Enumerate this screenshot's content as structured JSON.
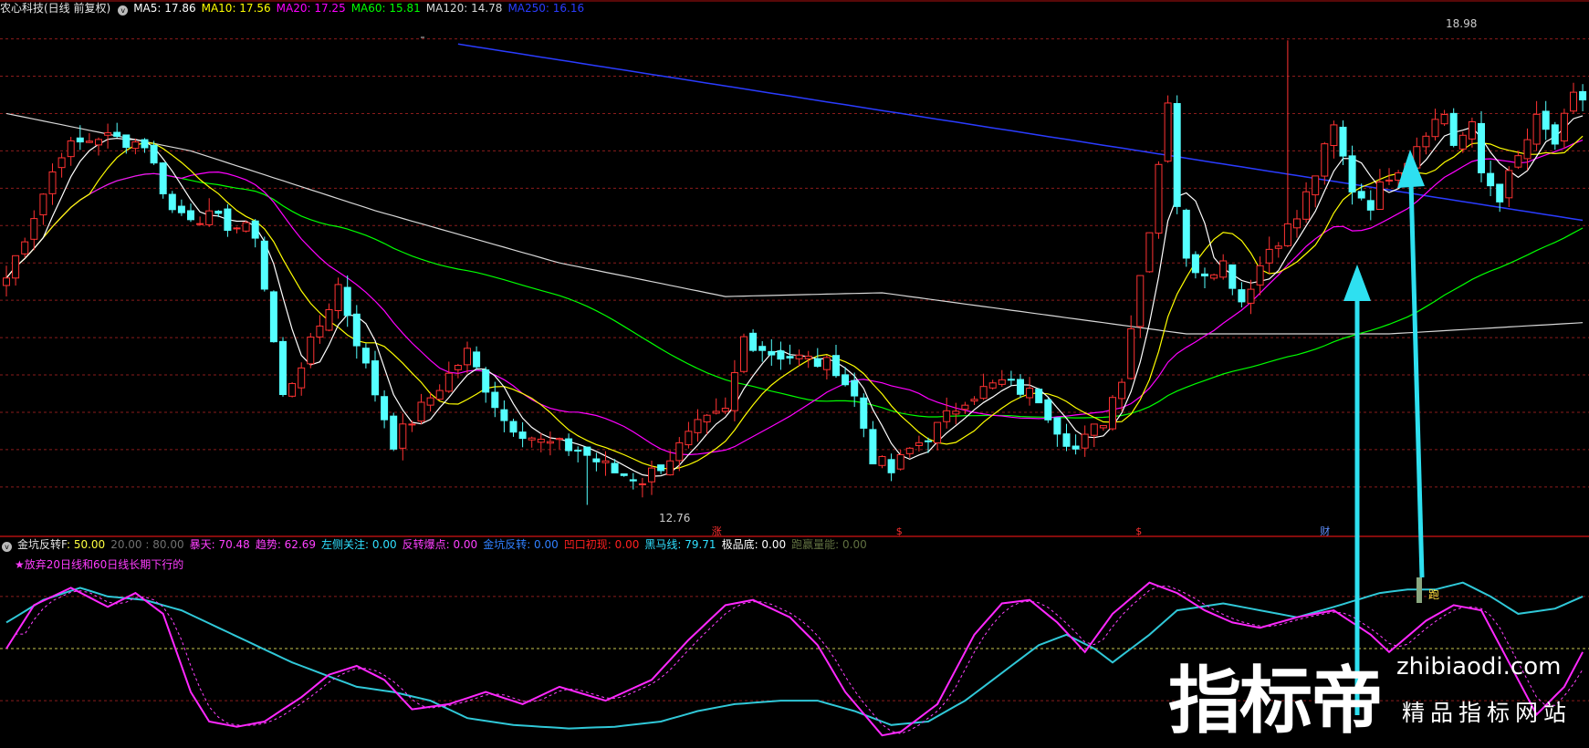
{
  "header": {
    "title": "农心科技(日线 前复权)",
    "indicators": [
      {
        "label": "MA5: 17.86",
        "color": "#ffffff"
      },
      {
        "label": "MA10: 17.56",
        "color": "#ffff00"
      },
      {
        "label": "MA20: 17.25",
        "color": "#ff00ff"
      },
      {
        "label": "MA60: 15.81",
        "color": "#00ff00"
      },
      {
        "label": "MA120: 14.78",
        "color": "#d8d8d8"
      },
      {
        "label": "MA250: 16.16",
        "color": "#2a3cff"
      }
    ]
  },
  "sub_header": {
    "title": "金坑反转F",
    "items": [
      {
        "label": ": 50.00",
        "color": "#ffff40"
      },
      {
        "label": "20.00 : 80.00",
        "color": "#707070"
      },
      {
        "label": "暴天: 70.48",
        "color": "#ff40ff"
      },
      {
        "label": "趋势: 62.69",
        "color": "#ff40ff"
      },
      {
        "label": "左侧关注: 0.00",
        "color": "#30e0ff"
      },
      {
        "label": "反转爆点: 0.00",
        "color": "#ff40ff"
      },
      {
        "label": "金坑反转: 0.00",
        "color": "#3080ff"
      },
      {
        "label": "凹口初现: 0.00",
        "color": "#ff2020"
      },
      {
        "label": "黑马线: 79.71",
        "color": "#30e0ff"
      },
      {
        "label": "极品底: 0.00",
        "color": "#ffffff"
      },
      {
        "label": "跑赢量能: 0.00",
        "color": "#607040"
      }
    ],
    "note": "★放弃20日线和60日线长期下行的"
  },
  "price_annotations": {
    "high_label": "18.98",
    "low_label": "12.76",
    "markers": [
      {
        "text": "涨",
        "color": "#ff3030",
        "index": 77
      },
      {
        "text": "$",
        "color": "#ff3030",
        "index": 97
      },
      {
        "text": "$",
        "color": "#ff3030",
        "index": 123
      },
      {
        "text": "财",
        "color": "#6090ff",
        "index": 143
      }
    ]
  },
  "signal_label": "跑",
  "watermark": {
    "big": "指标帝",
    "site": "zhibiaodi.com",
    "sub": "精品指标网站"
  },
  "colors": {
    "up": "#ff3232",
    "down": "#54ffff",
    "frame": "#b01010",
    "grid": "#8a1c1c"
  },
  "chart_data": [
    {
      "type": "candlestick",
      "title": "农心科技(日线 前复权)",
      "ylim": [
        12.4,
        19.3
      ],
      "levels": [
        13.0,
        13.5,
        14.0,
        14.5,
        15.0,
        15.5,
        16.0,
        16.5,
        17.0,
        17.5,
        18.0,
        18.5,
        19.0
      ],
      "series_names": [
        "MA5",
        "MA10",
        "MA20",
        "MA60",
        "MA120",
        "MA250"
      ],
      "pivots": [
        [
          0,
          15.8
        ],
        [
          6,
          17.5
        ],
        [
          10,
          17.7
        ],
        [
          15,
          17.6
        ],
        [
          18,
          16.7
        ],
        [
          22,
          16.6
        ],
        [
          27,
          16.4
        ],
        [
          30,
          14.2
        ],
        [
          33,
          14.9
        ],
        [
          36,
          15.7
        ],
        [
          39,
          14.6
        ],
        [
          42,
          13.6
        ],
        [
          46,
          14.2
        ],
        [
          50,
          14.8
        ],
        [
          54,
          13.9
        ],
        [
          58,
          13.6
        ],
        [
          62,
          13.5
        ],
        [
          66,
          13.2
        ],
        [
          69,
          13.1
        ],
        [
          72,
          13.4
        ],
        [
          75,
          13.8
        ],
        [
          78,
          14.0
        ],
        [
          80,
          15.0
        ],
        [
          83,
          14.8
        ],
        [
          87,
          14.7
        ],
        [
          90,
          14.6
        ],
        [
          92,
          14.2
        ],
        [
          94,
          13.4
        ],
        [
          96,
          13.2
        ],
        [
          98,
          13.5
        ],
        [
          101,
          13.8
        ],
        [
          104,
          14.2
        ],
        [
          108,
          14.4
        ],
        [
          112,
          14.2
        ],
        [
          114,
          13.8
        ],
        [
          116,
          13.5
        ],
        [
          119,
          13.9
        ],
        [
          121,
          14.5
        ],
        [
          124,
          16.5
        ],
        [
          126,
          18.2
        ],
        [
          127,
          16.8
        ],
        [
          128,
          16.0
        ],
        [
          130,
          15.9
        ],
        [
          132,
          16.0
        ],
        [
          134,
          15.5
        ],
        [
          137,
          16.2
        ],
        [
          140,
          16.6
        ],
        [
          142,
          17.2
        ],
        [
          144,
          17.8
        ],
        [
          146,
          17.0
        ],
        [
          148,
          16.8
        ],
        [
          150,
          17.2
        ],
        [
          152,
          17.4
        ],
        [
          154,
          17.8
        ],
        [
          156,
          18.0
        ],
        [
          157,
          17.6
        ],
        [
          159,
          17.8
        ],
        [
          160,
          17.2
        ],
        [
          162,
          16.9
        ],
        [
          164,
          17.4
        ],
        [
          166,
          17.9
        ],
        [
          168,
          17.6
        ],
        [
          170,
          18.2
        ]
      ],
      "ma250": [
        [
          49,
          18.93
        ],
        [
          171,
          16.57
        ]
      ],
      "ma120": [
        [
          0,
          18.0
        ],
        [
          20,
          17.5
        ],
        [
          40,
          16.7
        ],
        [
          60,
          16.0
        ],
        [
          78,
          15.55
        ],
        [
          95,
          15.6
        ],
        [
          110,
          15.35
        ],
        [
          128,
          15.05
        ],
        [
          150,
          15.05
        ],
        [
          171,
          15.2
        ]
      ]
    },
    {
      "type": "line",
      "title": "金坑反转F",
      "ylim": [
        -2,
        102
      ],
      "ref_lines": [
        20,
        50,
        80
      ],
      "series_names": [
        "暴天",
        "趋势"
      ],
      "magenta_pivots": [
        [
          0,
          50
        ],
        [
          3,
          75
        ],
        [
          7,
          85
        ],
        [
          11,
          74
        ],
        [
          14,
          82
        ],
        [
          17,
          70
        ],
        [
          20,
          25
        ],
        [
          22,
          8
        ],
        [
          25,
          5
        ],
        [
          28,
          8
        ],
        [
          32,
          22
        ],
        [
          35,
          35
        ],
        [
          38,
          40
        ],
        [
          41,
          32
        ],
        [
          44,
          15
        ],
        [
          48,
          18
        ],
        [
          52,
          25
        ],
        [
          56,
          18
        ],
        [
          60,
          28
        ],
        [
          65,
          20
        ],
        [
          70,
          32
        ],
        [
          74,
          55
        ],
        [
          78,
          75
        ],
        [
          81,
          78
        ],
        [
          85,
          68
        ],
        [
          88,
          52
        ],
        [
          91,
          25
        ],
        [
          95,
          0
        ],
        [
          97,
          2
        ],
        [
          101,
          18
        ],
        [
          105,
          58
        ],
        [
          108,
          76
        ],
        [
          111,
          78
        ],
        [
          114,
          65
        ],
        [
          117,
          48
        ],
        [
          120,
          70
        ],
        [
          124,
          88
        ],
        [
          127,
          82
        ],
        [
          130,
          72
        ],
        [
          133,
          65
        ],
        [
          136,
          62
        ],
        [
          140,
          68
        ],
        [
          144,
          72
        ],
        [
          148,
          58
        ],
        [
          150,
          48
        ],
        [
          154,
          66
        ],
        [
          157,
          75
        ],
        [
          160,
          72
        ],
        [
          163,
          42
        ],
        [
          166,
          12
        ],
        [
          169,
          28
        ],
        [
          171,
          48
        ]
      ],
      "cyan_pivots": [
        [
          0,
          65
        ],
        [
          4,
          78
        ],
        [
          8,
          85
        ],
        [
          11,
          80
        ],
        [
          15,
          78
        ],
        [
          19,
          72
        ],
        [
          23,
          62
        ],
        [
          27,
          52
        ],
        [
          31,
          42
        ],
        [
          35,
          34
        ],
        [
          38,
          28
        ],
        [
          42,
          25
        ],
        [
          46,
          20
        ],
        [
          50,
          10
        ],
        [
          55,
          6
        ],
        [
          61,
          4
        ],
        [
          66,
          5
        ],
        [
          71,
          8
        ],
        [
          75,
          14
        ],
        [
          79,
          18
        ],
        [
          84,
          20
        ],
        [
          88,
          20
        ],
        [
          92,
          14
        ],
        [
          96,
          6
        ],
        [
          100,
          8
        ],
        [
          104,
          20
        ],
        [
          108,
          36
        ],
        [
          112,
          52
        ],
        [
          115,
          58
        ],
        [
          118,
          50
        ],
        [
          120,
          42
        ],
        [
          124,
          58
        ],
        [
          127,
          72
        ],
        [
          132,
          76
        ],
        [
          136,
          72
        ],
        [
          140,
          68
        ],
        [
          144,
          74
        ],
        [
          149,
          82
        ],
        [
          152,
          84
        ],
        [
          155,
          84
        ],
        [
          158,
          88
        ],
        [
          161,
          80
        ],
        [
          164,
          70
        ],
        [
          168,
          73
        ],
        [
          171,
          80
        ]
      ]
    }
  ]
}
